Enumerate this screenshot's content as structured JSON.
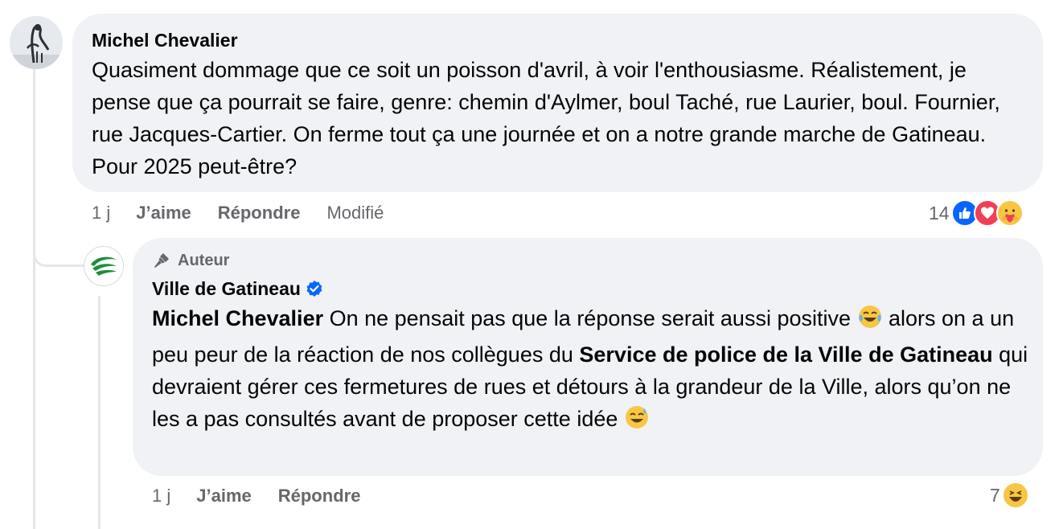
{
  "comment": {
    "author": "Michel Chevalier",
    "text": "Quasiment dommage que ce soit un poisson d'avril, à voir l'enthousiasme. Réalistement, je pense que ça pourrait se faire, genre: chemin d'Aylmer, boul Taché, rue Laurier, boul. Fournier, rue Jacques-Cartier. On ferme tout ça une journée et on a notre grande marche de Gatineau. Pour 2025 peut-être?",
    "time": "1 j",
    "like_label": "J’aime",
    "reply_label": "Répondre",
    "edited_label": "Modifié",
    "reaction_count": "14",
    "reactions": [
      "like-icon",
      "love-icon",
      "care-icon"
    ]
  },
  "reply": {
    "badge": "Auteur",
    "author": "Ville de Gatineau",
    "mention": "Michel Chevalier",
    "text_1": " On ne pensait pas que la réponse serait aussi positive ",
    "text_2": " alors on a un peu peur de la réaction de nos collègues du ",
    "bold_phrase": "Service de police de la Ville de Gatineau",
    "text_3": " qui devraient gérer ces fermetures de rues et détours à la grandeur de la Ville, alors qu’on ne les a pas consultés avant de proposer cette idée ",
    "time": "1 j",
    "like_label": "J’aime",
    "reply_label": "Répondre",
    "reaction_count": "7",
    "reactions": [
      "haha-icon"
    ]
  },
  "colors": {
    "bubble": "#f0f2f5",
    "secondary_text": "#65676b",
    "like_blue": "#0866ff",
    "love_red": "#f33e58",
    "verified_blue": "#0866ff"
  }
}
